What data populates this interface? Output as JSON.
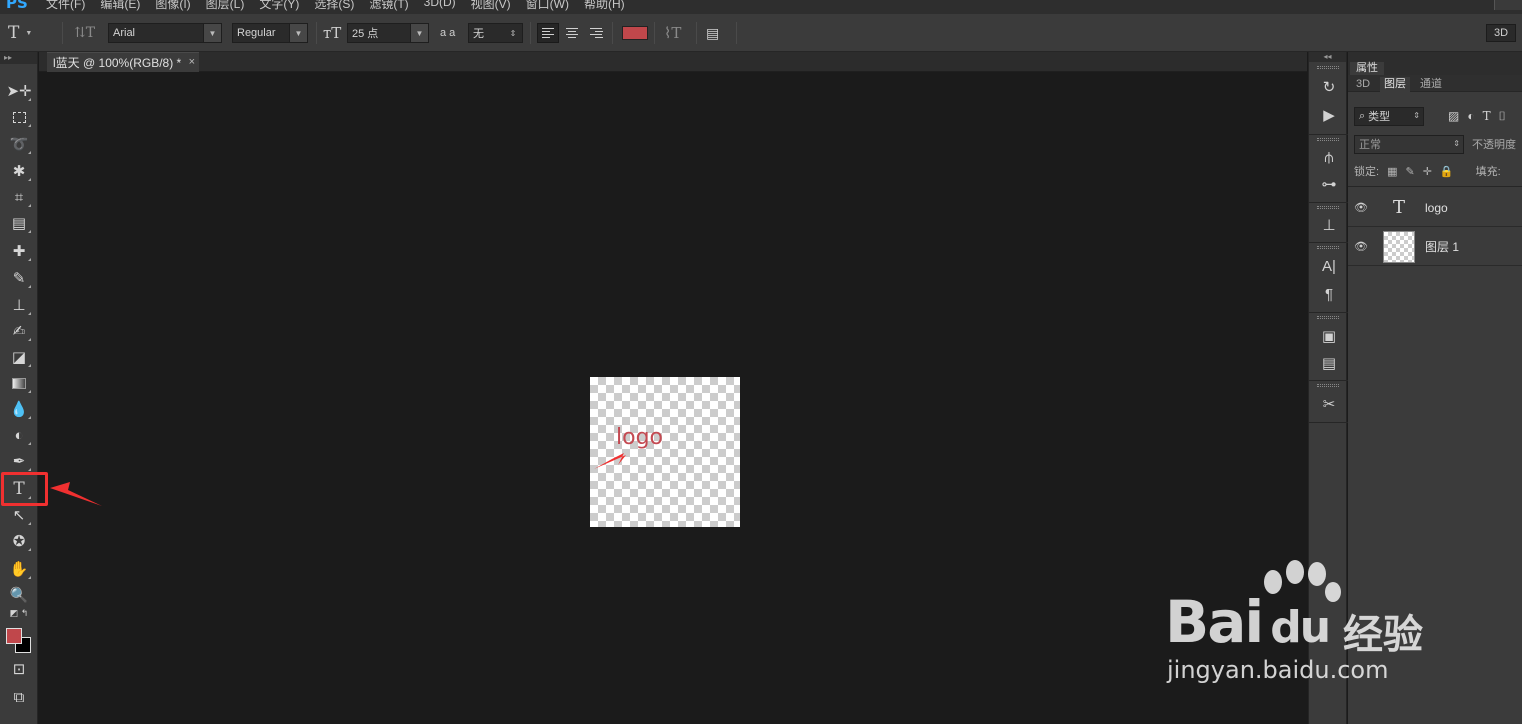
{
  "menubar": {
    "app_logo": "PS",
    "items": [
      "文件(F)",
      "编辑(E)",
      "图像(I)",
      "图层(L)",
      "文字(Y)",
      "选择(S)",
      "滤镜(T)",
      "3D(D)",
      "视图(V)",
      "窗口(W)",
      "帮助(H)"
    ]
  },
  "options": {
    "font_family": "Arial",
    "font_style": "Regular",
    "font_size": "25 点",
    "antialias": "无",
    "antialias_glyph": "a a",
    "color": "#c0474b",
    "workspace": "3D"
  },
  "document": {
    "tab_title": "l蓝天 @ 100%(RGB/8) *",
    "close_glyph": "×",
    "canvas_text": "logo",
    "text_color": "#c44a52"
  },
  "toolbar": {
    "collapse_glyph": "▸▸",
    "selected_tool": "type-tool",
    "foreground_color": "#c0474b",
    "background_color": "#000000"
  },
  "panel": {
    "properties_tab": "属性",
    "tabs": [
      "3D",
      "图层",
      "通道"
    ],
    "filter_kind": "类型",
    "blend_mode": "正常",
    "opacity_label": "不透明度",
    "lock_label": "锁定:",
    "fill_label": "填充:",
    "layers": [
      {
        "name": "logo",
        "type": "text"
      },
      {
        "name": "图层 1",
        "type": "pixel"
      }
    ]
  },
  "watermark": {
    "brand": "Bai",
    "brand_du": "du",
    "brand_suffix": "经验",
    "url": "jingyan.baidu.com"
  }
}
